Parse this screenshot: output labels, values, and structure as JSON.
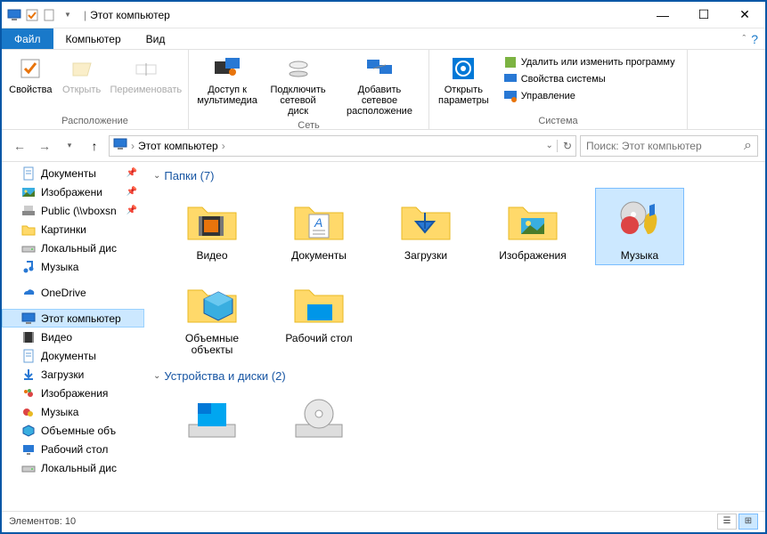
{
  "window": {
    "title": "Этот компьютер",
    "separator": "|"
  },
  "tabs": {
    "file": "Файл",
    "computer": "Компьютер",
    "view": "Вид"
  },
  "ribbon": {
    "location": {
      "properties": "Свойства",
      "open": "Открыть",
      "rename": "Переименовать",
      "group": "Расположение"
    },
    "network": {
      "multimedia": "Доступ к\nмультимедиа",
      "netdrive": "Подключить\nсетевой диск",
      "netlocation": "Добавить сетевое\nрасположение",
      "group": "Сеть"
    },
    "system": {
      "settings": "Открыть\nпараметры",
      "uninstall": "Удалить или изменить программу",
      "sysprops": "Свойства системы",
      "manage": "Управление",
      "group": "Система"
    }
  },
  "address": {
    "location": "Этот компьютер",
    "refresh": "↻"
  },
  "search": {
    "placeholder": "Поиск: Этот компьютер"
  },
  "sidebar": {
    "items": [
      {
        "label": "Документы",
        "icon": "doc",
        "pinned": true
      },
      {
        "label": "Изображени",
        "icon": "img",
        "pinned": true
      },
      {
        "label": "Public (\\\\vboxsn",
        "icon": "net",
        "pinned": true
      },
      {
        "label": "Картинки",
        "icon": "folder"
      },
      {
        "label": "Локальный дис",
        "icon": "disk"
      },
      {
        "label": "Музыка",
        "icon": "music"
      },
      {
        "label": "OneDrive",
        "icon": "onedrive",
        "spacer": true
      },
      {
        "label": "Этот компьютер",
        "icon": "pc",
        "selected": true,
        "spacer": true
      },
      {
        "label": "Видео",
        "icon": "video"
      },
      {
        "label": "Документы",
        "icon": "doc"
      },
      {
        "label": "Загрузки",
        "icon": "download"
      },
      {
        "label": "Изображения",
        "icon": "img2"
      },
      {
        "label": "Музыка",
        "icon": "music2"
      },
      {
        "label": "Объемные объ",
        "icon": "3d"
      },
      {
        "label": "Рабочий стол",
        "icon": "desktop"
      },
      {
        "label": "Локальный дис",
        "icon": "disk"
      }
    ]
  },
  "sections": {
    "folders": {
      "title": "Папки (7)"
    },
    "drives": {
      "title": "Устройства и диски (2)"
    }
  },
  "items": {
    "folders": [
      {
        "label": "Видео",
        "type": "video"
      },
      {
        "label": "Документы",
        "type": "doc"
      },
      {
        "label": "Загрузки",
        "type": "download"
      },
      {
        "label": "Изображения",
        "type": "img"
      },
      {
        "label": "Музыка",
        "type": "music",
        "selected": true
      },
      {
        "label": "Объемные объекты",
        "type": "3d"
      },
      {
        "label": "Рабочий стол",
        "type": "desktop"
      }
    ]
  },
  "status": {
    "count": "Элементов: 10"
  }
}
